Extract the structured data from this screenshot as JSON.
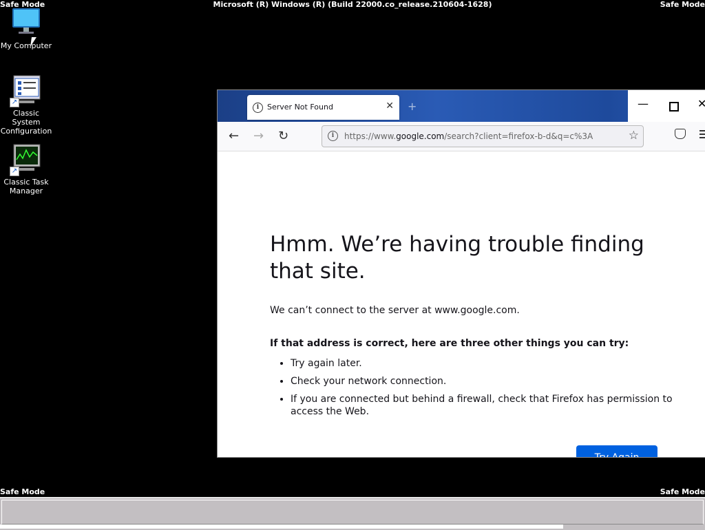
{
  "desktop": {
    "safe_mode_label": "Safe Mode",
    "build_text": "Microsoft (R) Windows (R) (Build 22000.co_release.210604-1628)",
    "icons": [
      {
        "label": "My Computer",
        "icon": "monitor-icon"
      },
      {
        "label": "Classic System Configuration",
        "icon": "system-config-icon"
      },
      {
        "label": "Classic Task Manager",
        "icon": "task-manager-icon"
      }
    ]
  },
  "browser": {
    "tab": {
      "title": "Server Not Found",
      "icon": "info-icon"
    },
    "url": {
      "prefix": "https://www.",
      "host": "google.com",
      "path": "/search?client=firefox-b-d&q=c%3A"
    },
    "error": {
      "heading": "Hmm. We’re having trouble finding that site.",
      "description": "We can’t connect to the server at www.google.com.",
      "subheading": "If that address is correct, here are three other things you can try:",
      "tips": [
        "Try again later.",
        "Check your network connection.",
        "If you are connected but behind a firewall, check that Firefox has permission to access the Web."
      ],
      "button_label": "Try Again"
    }
  },
  "colors": {
    "desktop_bg": "#000000",
    "tabstrip": "#2a5bb5",
    "primary_button": "#0061e0",
    "taskbar": "#c3bfc2"
  }
}
